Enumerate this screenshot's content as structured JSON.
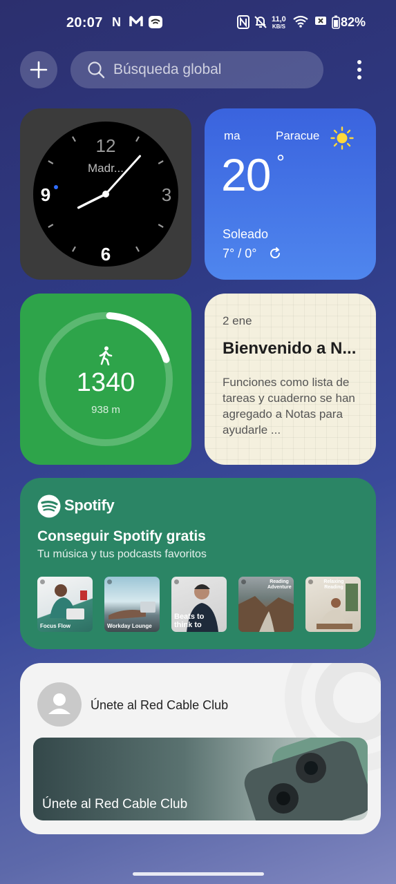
{
  "status_bar": {
    "time": "20:07",
    "left_icons": [
      "N",
      "M",
      "wifi-calling"
    ],
    "nfc_label": "N",
    "net_speed_value": "11,0",
    "net_speed_unit": "KB/S",
    "battery_percent": "82%"
  },
  "search": {
    "placeholder": "Búsqueda global"
  },
  "clock_widget": {
    "city": "Madr...",
    "numerals": {
      "top": "12",
      "right": "3",
      "bottom": "6",
      "left": "9"
    },
    "hour": 8,
    "minute": 7
  },
  "weather_widget": {
    "location_1": "ma",
    "location_2": "Paracue",
    "temperature": "20",
    "degree_symbol": "°",
    "condition": "Soleado",
    "range": "7° / 0°",
    "sun_color": "#ffd83b"
  },
  "steps_widget": {
    "count": "1340",
    "distance": "938 m",
    "progress": 0.2
  },
  "notes_widget": {
    "date": "2 ene",
    "title": "Bienvenido a N...",
    "body": "Funciones como lista de tareas y cuaderno se han agregado a Notas para ayudarle ..."
  },
  "spotify_widget": {
    "brand": "Spotify",
    "title": "Conseguir Spotify gratis",
    "subtitle": "Tu música y tus podcasts favoritos",
    "playlists": [
      {
        "caption": "Focus Flow"
      },
      {
        "caption": "Workday Lounge"
      },
      {
        "caption": "Beats to think to"
      },
      {
        "caption": "Reading Adventure"
      },
      {
        "caption": "Relaxing Reading"
      }
    ]
  },
  "club_widget": {
    "header": "Únete al Red Cable Club",
    "banner_text": "Únete al Red Cable Club"
  },
  "colors": {
    "steps_green": "#2ea44a",
    "spotify_green": "#2b8565",
    "weather_blue": "#3a63de"
  }
}
